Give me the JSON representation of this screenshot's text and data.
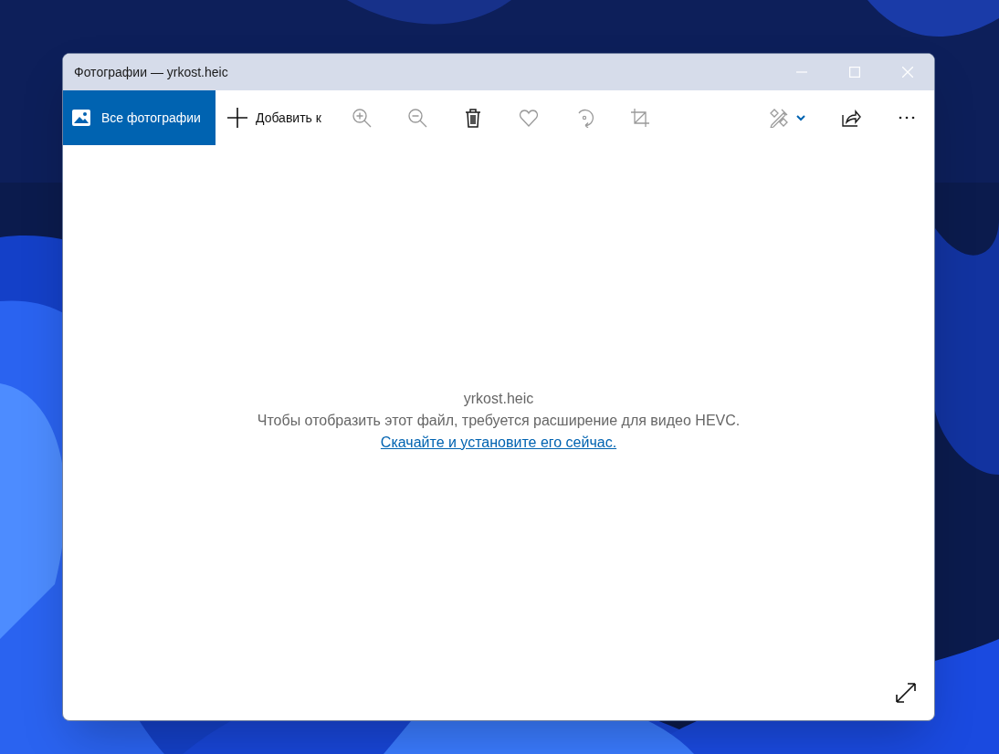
{
  "window": {
    "title": "Фотографии — yrkost.heic"
  },
  "toolbar": {
    "nav_button": {
      "label": "Все фотографии",
      "selected": true
    },
    "add_button": {
      "label": "Добавить к"
    },
    "tools": [
      {
        "disabled": true
      },
      {
        "disabled": true
      },
      {
        "disabled": false
      },
      {
        "disabled": true
      },
      {
        "disabled": true
      },
      {
        "disabled": true
      },
      {
        "disabled": true
      },
      {
        "disabled": false
      },
      {
        "disabled": false
      }
    ]
  },
  "message": {
    "file_name": "yrkost.heic",
    "text": "Чтобы отобразить этот файл, требуется расширение для видео HEVC.",
    "link": "Скачайте и установите его сейчас."
  }
}
